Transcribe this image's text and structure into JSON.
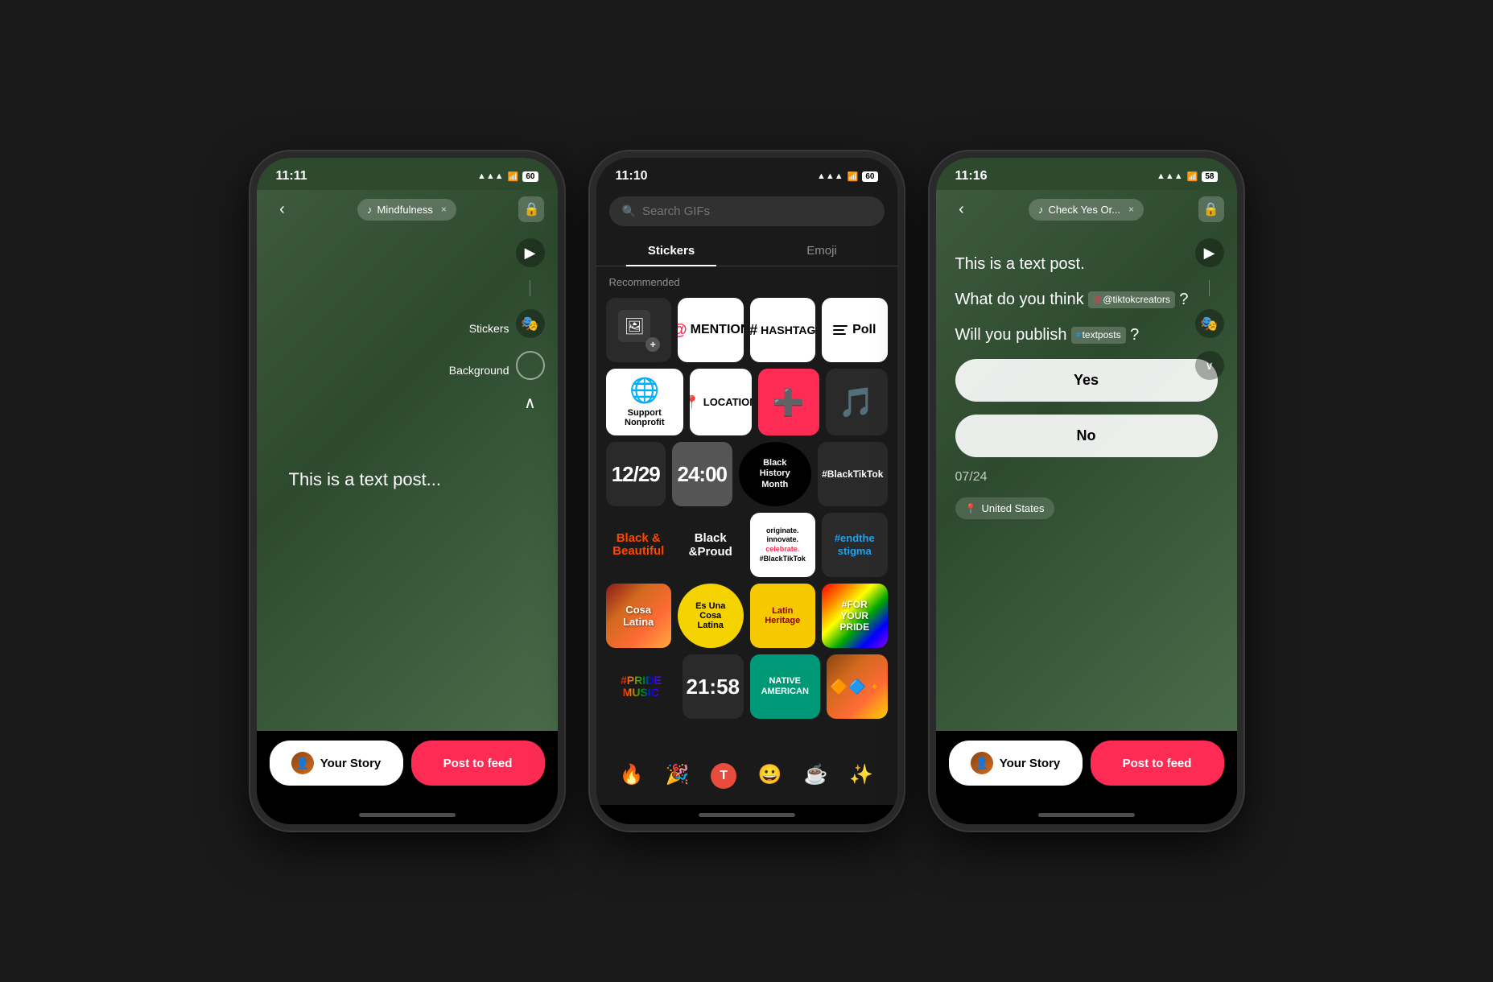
{
  "phone1": {
    "status": {
      "time": "11:11",
      "signal": "●●●",
      "wifi": "WiFi",
      "battery": "60"
    },
    "music_tag": "Mindfulness",
    "close_x": "×",
    "toolbar": {
      "stickers_label": "Stickers",
      "background_label": "Background"
    },
    "text_content": "This is a text post...",
    "bottom": {
      "your_story": "Your Story",
      "post_to_feed": "Post to feed"
    }
  },
  "phone2": {
    "status": {
      "time": "11:10",
      "battery": "60"
    },
    "search_placeholder": "Search GIFs",
    "tabs": [
      "Stickers",
      "Emoji"
    ],
    "active_tab": "Stickers",
    "recommended_label": "Recommended",
    "stickers": [
      {
        "id": "add",
        "type": "add"
      },
      {
        "id": "mention",
        "label": "MENTION",
        "type": "mention"
      },
      {
        "id": "hashtag",
        "label": "HASHTAG",
        "type": "hashtag"
      },
      {
        "id": "poll",
        "label": "Poll",
        "type": "poll"
      },
      {
        "id": "nonprofit",
        "label": "Support Nonprofit",
        "type": "nonprofit"
      },
      {
        "id": "location",
        "label": "LOCATION",
        "type": "location"
      },
      {
        "id": "medical",
        "type": "medical"
      },
      {
        "id": "tiktok",
        "type": "tiktok"
      },
      {
        "id": "date",
        "label": "12/29",
        "type": "date"
      },
      {
        "id": "time",
        "label": "24:00",
        "type": "time"
      },
      {
        "id": "bhm",
        "label": "Black History Month",
        "type": "bhm"
      },
      {
        "id": "blacktiktok",
        "label": "#BlackTikTok",
        "type": "blacktiktok"
      },
      {
        "id": "bb",
        "label": "Black & Beautiful",
        "type": "bb"
      },
      {
        "id": "bp",
        "label": "Black &Proud",
        "type": "bp"
      },
      {
        "id": "oic",
        "label": "originate. innovate. celebrate. #BlackTikTok",
        "type": "oic"
      },
      {
        "id": "ets",
        "label": "#endthe stigma",
        "type": "endthestigma"
      },
      {
        "id": "cosa1",
        "label": "Cosa Latina",
        "type": "cosalat1"
      },
      {
        "id": "cosa2",
        "label": "Es Una Cosa Latina",
        "type": "cosalat2"
      },
      {
        "id": "lh",
        "label": "Latin Heritage",
        "type": "latinheritage"
      },
      {
        "id": "fyp",
        "label": "#FOR YOUR PRIDE",
        "type": "foryourpride"
      },
      {
        "id": "pm",
        "label": "#PRIDE MUSIC",
        "type": "pridemusic"
      },
      {
        "id": "time2",
        "label": "21:58",
        "type": "time2"
      },
      {
        "id": "native",
        "label": "NATIVE AMERICAN",
        "type": "native"
      },
      {
        "id": "pattern",
        "type": "pattern"
      }
    ],
    "emojis": [
      "🔥",
      "🎉",
      "🅣",
      "😀",
      "☕",
      "✨"
    ]
  },
  "phone3": {
    "status": {
      "time": "11:16",
      "battery": "58"
    },
    "music_tag": "Check Yes Or...",
    "close_x": "×",
    "poll": {
      "line1": "This is a text post.",
      "line2_prefix": "What do you think ",
      "line2_tag": "@tiktokcreators",
      "line2_suffix": "?",
      "line3_prefix": "Will you publish ",
      "line3_tag": "#textposts",
      "line3_suffix": "?",
      "option_yes": "Yes",
      "option_no": "No",
      "date": "07/24",
      "location": "United States"
    },
    "bottom": {
      "your_story": "Your Story",
      "post_to_feed": "Post to feed"
    }
  }
}
